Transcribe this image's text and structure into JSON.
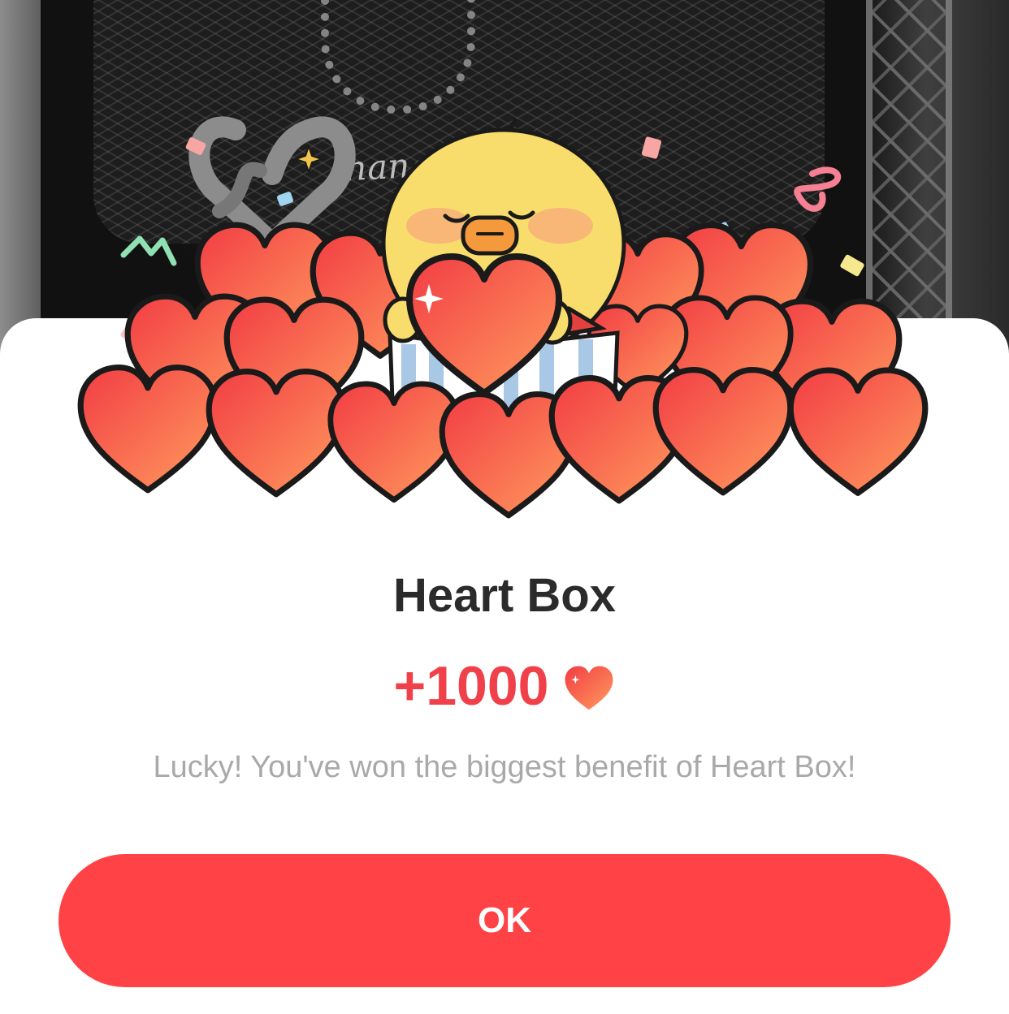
{
  "background": {
    "shirt_text": "hange"
  },
  "dialog": {
    "title": "Heart Box",
    "reward_amount": "+1000",
    "reward_icon": "heart-icon",
    "message": "Lucky! You've won the biggest benefit of Heart Box!",
    "ok_label": "OK"
  },
  "colors": {
    "accent": "#fe4245",
    "amount": "#f0414a",
    "title": "#2b2b2b",
    "message": "#a9a9a9",
    "heart_top": "#f24848",
    "heart_bottom": "#ff9a5c",
    "chick": "#f8dc6c"
  }
}
